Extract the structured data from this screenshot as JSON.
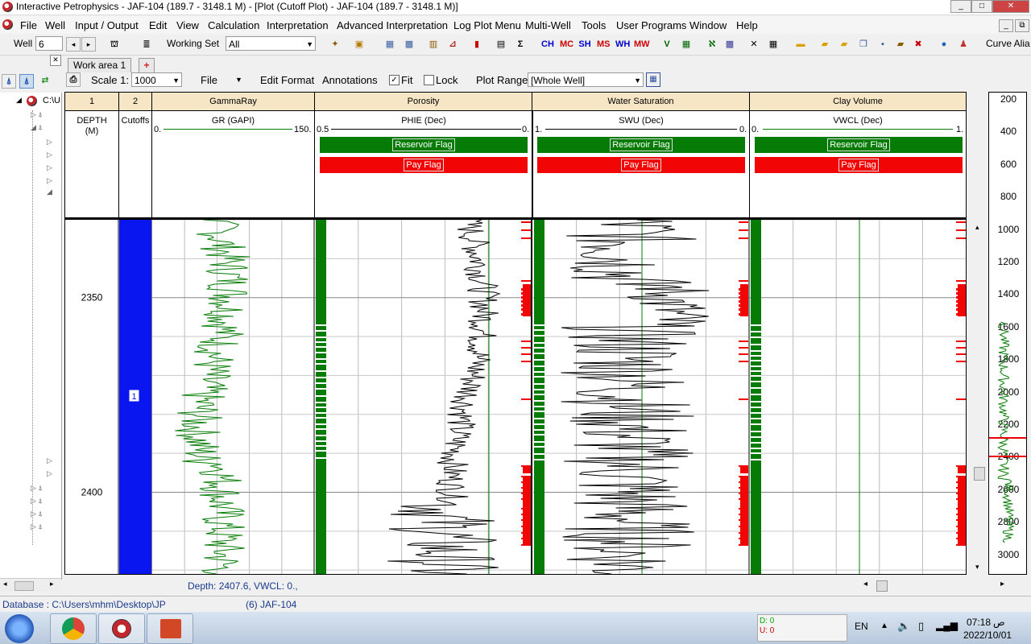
{
  "window": {
    "app_name": "Interactive Petrophysics",
    "title_rest": "JAF-104 (189.7 - 3148.1 M) - [Plot (Cutoff Plot) - JAF-104 (189.7 - 3148.1 M)]"
  },
  "menu": [
    "File",
    "Well",
    "Input / Output",
    "Edit",
    "View",
    "Calculation",
    "Interpretation",
    "Advanced Interpretation",
    "Log Plot Menu",
    "Multi-Well",
    "Tools",
    "User Programs",
    "Window",
    "Help"
  ],
  "toolbar": {
    "well_label": "Well",
    "well_value": "6",
    "working_set_label": "Working Set",
    "working_set_value": "All",
    "shortcut_labels": [
      "CH",
      "MC",
      "SH",
      "MS",
      "WH",
      "MW"
    ],
    "curve_alias": "Curve Alia"
  },
  "tabs": {
    "work_area": "Work area 1",
    "add_tab": "+"
  },
  "tree": {
    "root_label": "C:\\U"
  },
  "plot_toolbar": {
    "scale_label": "Scale 1:",
    "scale_value": "1000",
    "file_label": "File",
    "edit_format": "Edit Format",
    "annotations": "Annotations",
    "fit_label": "Fit",
    "fit_checked": true,
    "lock_label": "Lock",
    "lock_checked": false,
    "plot_range_label": "Plot Range",
    "plot_range_value": "[Whole Well]"
  },
  "tracks": [
    {
      "title": "1",
      "curve": "DEPTH",
      "unit": "(M)",
      "left": "",
      "right": ""
    },
    {
      "title": "2",
      "curve": "Cutoffs",
      "unit": "",
      "left": "",
      "right": ""
    },
    {
      "title": "GammaRay",
      "curve": "GR (GAPI)",
      "unit": "",
      "left": "0.",
      "right": "150."
    },
    {
      "title": "Porosity",
      "curve": "PHIE (Dec)",
      "unit": "",
      "left": "0.5",
      "right": "0."
    },
    {
      "title": "Water Saturation",
      "curve": "SWU (Dec)",
      "unit": "",
      "left": "1.",
      "right": "0."
    },
    {
      "title": "Clay Volume",
      "curve": "VWCL (Dec)",
      "unit": "",
      "left": "0.",
      "right": "1."
    }
  ],
  "flags": {
    "reservoir": "Reservoir Flag",
    "pay": "Pay Flag"
  },
  "plot_depths": {
    "top_depth": 2330,
    "bottom_depth": 2421,
    "labels": [
      "2350",
      "2400"
    ]
  },
  "cutoff_zone_label": "1",
  "depth_scale": [
    "200",
    "400",
    "600",
    "800",
    "1000",
    "1200",
    "1400",
    "1600",
    "1800",
    "2000",
    "2200",
    "2400",
    "2600",
    "2800",
    "3000"
  ],
  "status": {
    "readout": "Depth: 2407.6,  VWCL: 0.,"
  },
  "database": {
    "label": "Database : C:\\Users\\mhm\\Desktop\\JP",
    "well": "(6) JAF-104"
  },
  "taskbar": {
    "d_label": "D: 0",
    "u_label": "U: 0",
    "lang": "EN",
    "time": "07:18",
    "ampm": "ص",
    "date": "2022/10/01"
  },
  "colors": {
    "track_header": "#f7e6c6",
    "green": "#067c06",
    "red": "#f20505",
    "cutoff_blue": "#0a16f0"
  }
}
